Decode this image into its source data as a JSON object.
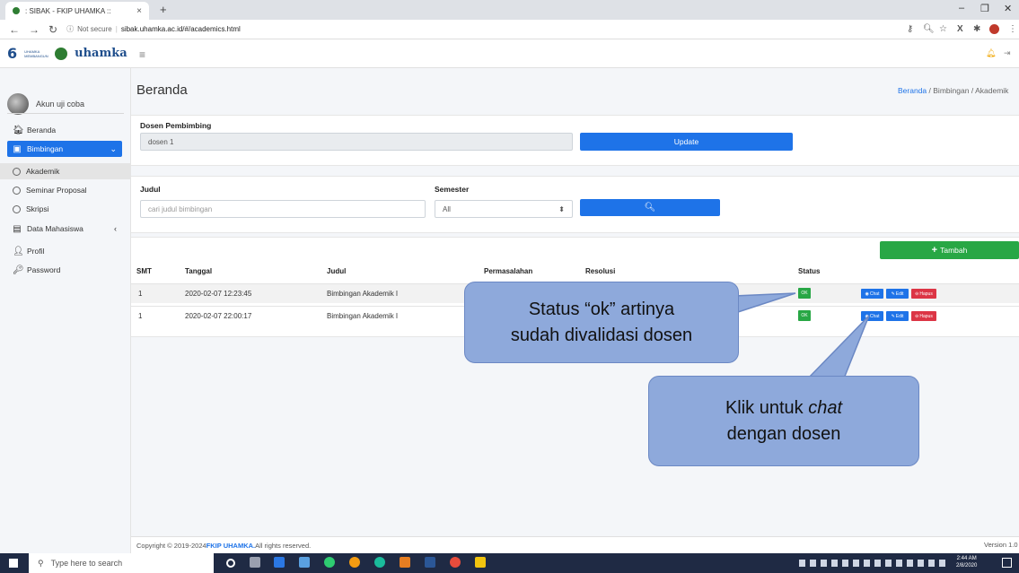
{
  "browser": {
    "tab_title": ": SIBAK - FKIP UHAMKA ::",
    "tab_close": "×",
    "new_tab": "+",
    "security": "Not secure",
    "url": "sibak.uhamka.ac.id/#/academics.html",
    "win_minimize": "–",
    "win_restore": "❐",
    "win_close": "✕"
  },
  "logo": {
    "number": "6",
    "tagline": "UHAMKA MEMBANGUN",
    "brand": "uhamka"
  },
  "user": {
    "name": "Akun uji coba"
  },
  "sidebar": {
    "items": [
      {
        "label": "Beranda",
        "icon": "home-icon"
      },
      {
        "label": "Bimbingan",
        "icon": "book-icon"
      },
      {
        "label": "Akademik"
      },
      {
        "label": "Seminar Proposal"
      },
      {
        "label": "Skripsi"
      },
      {
        "label": "Data Mahasiswa",
        "icon": "address-book-icon"
      },
      {
        "label": "Profil",
        "icon": "user-icon"
      },
      {
        "label": "Password",
        "icon": "key-icon"
      }
    ]
  },
  "page": {
    "title": "Beranda",
    "breadcrumb": [
      "Beranda",
      "/",
      "Bimbingan",
      "/",
      "Akademik"
    ]
  },
  "dosen_form": {
    "label": "Dosen Pembimbing",
    "value": "dosen 1",
    "button": "Update"
  },
  "filter": {
    "judul_label": "Judul",
    "judul_placeholder": "cari judul bimbingan",
    "semester_label": "Semester",
    "semester_value": "All"
  },
  "table": {
    "add_button": "Tambah",
    "headers": [
      "SMT",
      "Tanggal",
      "Judul",
      "Permasalahan",
      "Resolusi",
      "Status"
    ],
    "rows": [
      {
        "smt": "1",
        "tanggal": "2020-02-07 12:23:45",
        "judul": "Bimbingan Akademik I",
        "status": "OK"
      },
      {
        "smt": "1",
        "tanggal": "2020-02-07 22:00:17",
        "judul": "Bimbingan Akademik I",
        "status": "OK"
      }
    ],
    "actions": {
      "chat": "Chat",
      "edit": "Edit",
      "hapus": "Hapus"
    }
  },
  "callouts": {
    "status_line1": "Status “ok” artinya",
    "status_line2": "sudah divalidasi dosen",
    "chat_line1_a": "Klik untuk ",
    "chat_line1_b": "chat",
    "chat_line2": "dengan dosen"
  },
  "footer": {
    "copyright_pre": "Copyright © 2019-2024 ",
    "copyright_org": "FKIP UHAMKA.",
    "copyright_post": " All rights reserved.",
    "version": "Version 1.0"
  },
  "taskbar": {
    "search_placeholder": "Type here to search",
    "time": "2:44 AM",
    "date": "2/8/2020"
  },
  "colors": {
    "primary": "#1e73e8",
    "success": "#28a745",
    "danger": "#dc3545",
    "callout": "#8ea9db"
  }
}
